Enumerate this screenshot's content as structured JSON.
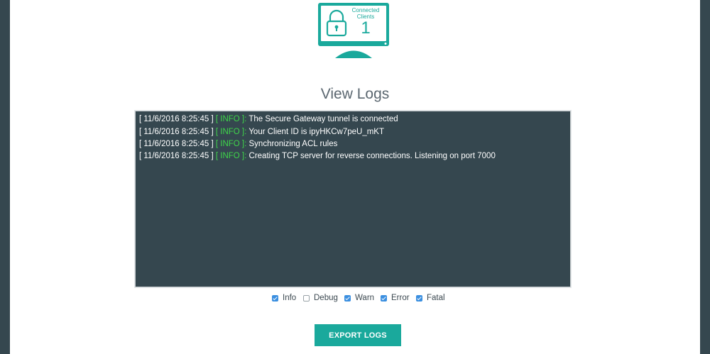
{
  "status": {
    "connected_label": "Connected Clients",
    "connected_count": "1"
  },
  "page": {
    "title": "View Logs"
  },
  "logs": [
    {
      "time": "[ 11/6/2016 8:25:45 ]",
      "level": "[ INFO ]:",
      "message": "The Secure Gateway tunnel is connected"
    },
    {
      "time": "[ 11/6/2016 8:25:45 ]",
      "level": "[ INFO ]:",
      "message": "Your Client ID is ipyHKCw7peU_mKT"
    },
    {
      "time": "[ 11/6/2016 8:25:45 ]",
      "level": "[ INFO ]:",
      "message": "Synchronizing ACL rules"
    },
    {
      "time": "[ 11/6/2016 8:25:45 ]",
      "level": "[ INFO ]:",
      "message": "Creating TCP server for reverse connections. Listening on port 7000"
    }
  ],
  "filters": [
    {
      "label": "Info",
      "checked": true
    },
    {
      "label": "Debug",
      "checked": false
    },
    {
      "label": "Warn",
      "checked": true
    },
    {
      "label": "Error",
      "checked": true
    },
    {
      "label": "Fatal",
      "checked": true
    }
  ],
  "actions": {
    "export_label": "EXPORT LOGS"
  },
  "colors": {
    "accent": "#1aa99c",
    "log_background": "#35474f",
    "info_level": "#3fd64a",
    "checkbox_checked": "#3b8fe0"
  },
  "icons": {
    "lock": "padlock-icon",
    "monitor": "monitor-icon"
  }
}
